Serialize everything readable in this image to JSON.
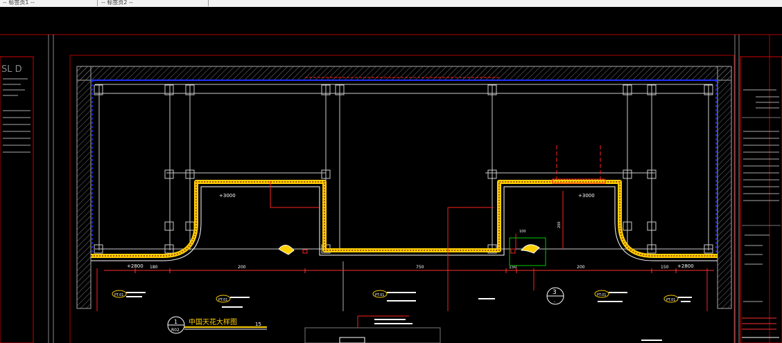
{
  "tabs": [
    {
      "label": "-- 标签页1 --"
    },
    {
      "label": "-- 标签页2 --"
    }
  ],
  "title_block_logo": "SL D",
  "elevations": {
    "ceiling_left": "+3000",
    "ceiling_right": "+3000",
    "floor_left": "+2800",
    "floor_right": "+2800"
  },
  "dimensions": [
    "180",
    "200",
    "750",
    "150",
    "200",
    "150",
    "100",
    "200"
  ],
  "material_tags": [
    "PT.01",
    "PT.01",
    "PT.01",
    "PT.01",
    "PT.01"
  ],
  "detail_callout": {
    "number": "3",
    "sheet": "-"
  },
  "drawing_title": {
    "number": "1",
    "sheet": "R02",
    "text": "中国天花大样图",
    "scale": "15"
  },
  "colors": {
    "background": "#000000",
    "frame": "#d40000",
    "wall": "#ffffff",
    "annotation": "#ff2020",
    "finish": "#ffd000",
    "detail_box": "#00cc00",
    "dim_line": "#ff3030"
  }
}
